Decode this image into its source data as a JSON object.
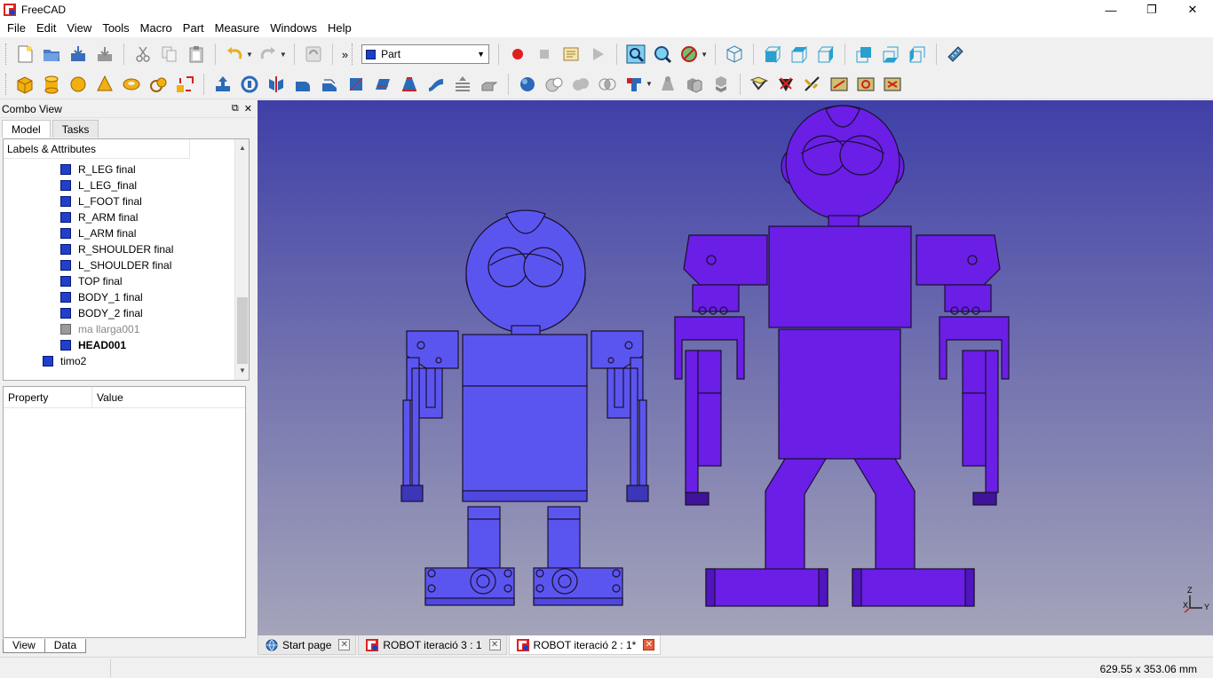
{
  "window": {
    "title": "FreeCAD",
    "minimize": "—",
    "restore": "❐",
    "close": "✕"
  },
  "menubar": [
    "File",
    "Edit",
    "View",
    "Tools",
    "Macro",
    "Part",
    "Measure",
    "Windows",
    "Help"
  ],
  "toolbar": {
    "overflow": "»",
    "workbench": "Part"
  },
  "combo_view": {
    "title": "Combo View",
    "tabs": [
      "Model",
      "Tasks"
    ],
    "active_tab": "Model",
    "tree_header": "Labels & Attributes",
    "tree_items": [
      {
        "label": "R_LEG final",
        "indent": 1,
        "style": "normal"
      },
      {
        "label": "L_LEG_final",
        "indent": 1,
        "style": "normal"
      },
      {
        "label": "L_FOOT final",
        "indent": 1,
        "style": "normal"
      },
      {
        "label": "R_ARM final",
        "indent": 1,
        "style": "normal"
      },
      {
        "label": "L_ARM final",
        "indent": 1,
        "style": "normal"
      },
      {
        "label": "R_SHOULDER final",
        "indent": 1,
        "style": "normal"
      },
      {
        "label": "L_SHOULDER final",
        "indent": 1,
        "style": "normal"
      },
      {
        "label": "TOP final",
        "indent": 1,
        "style": "normal"
      },
      {
        "label": "BODY_1 final",
        "indent": 1,
        "style": "normal"
      },
      {
        "label": "BODY_2 final",
        "indent": 1,
        "style": "normal"
      },
      {
        "label": "ma llarga001",
        "indent": 1,
        "style": "hidden"
      },
      {
        "label": "HEAD001",
        "indent": 1,
        "style": "bold"
      },
      {
        "label": "timo2",
        "indent": 0,
        "style": "normal"
      }
    ],
    "property_columns": [
      "Property",
      "Value"
    ],
    "bottom_tabs": [
      "View",
      "Data"
    ]
  },
  "document_tabs": [
    {
      "label": "Start page",
      "active": false,
      "icon": "globe-icon"
    },
    {
      "label": "ROBOT iteració 3 : 1",
      "active": false,
      "icon": "freecad-icon"
    },
    {
      "label": "ROBOT iteració 2 : 1*",
      "active": true,
      "icon": "freecad-icon"
    }
  ],
  "statusbar": {
    "dimensions": "629.55 x 353.06 mm"
  },
  "axis_labels": [
    "Z",
    "X",
    "Y"
  ],
  "colors": {
    "part_blue": "#5b55f0",
    "part_violet": "#6a1ee6",
    "viewport_top": "#3f3fa8",
    "viewport_bottom": "#a4a4ba"
  }
}
